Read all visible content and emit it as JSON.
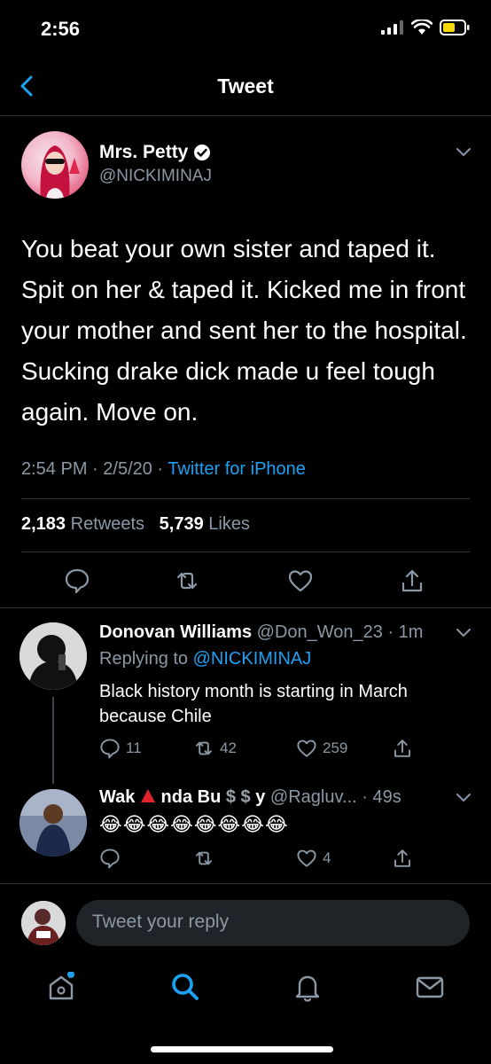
{
  "status": {
    "time": "2:56"
  },
  "header": {
    "title": "Tweet",
    "back_icon": "chevron-left-icon"
  },
  "main_tweet": {
    "author_name": "Mrs. Petty",
    "author_handle": "@NICKIMINAJ",
    "verified": true,
    "text": "You beat your own sister and taped it. Spit on her & taped it. Kicked me in front your mother and sent her to the hospital. Sucking drake dick made u feel tough again. Move on.",
    "time": "2:54 PM",
    "date": "2/5/20",
    "source": "Twitter for iPhone",
    "retweets_count": "2,183",
    "retweets_label": "Retweets",
    "likes_count": "5,739",
    "likes_label": "Likes"
  },
  "replies": [
    {
      "name": "Donovan Williams",
      "handle": "@Don_Won_23",
      "age": "1m",
      "replying_label": "Replying to",
      "replying_to": "@NICKIMINAJ",
      "text": "Black history month is starting in March because Chile",
      "reply_count": "11",
      "retweet_count": "42",
      "like_count": "259"
    },
    {
      "name_part1": "Wak",
      "name_part2": "nda Bu",
      "name_part3": "y",
      "handle": "@Ragluv...",
      "age": "49s",
      "text": "😂😂😂😂😂😂😂😂",
      "like_count": "4"
    }
  ],
  "composer": {
    "placeholder": "Tweet your reply"
  },
  "tabs": [
    "home-icon",
    "search-icon",
    "notifications-icon",
    "messages-icon"
  ],
  "colors": {
    "accent": "#1da1f2",
    "muted": "#8b98a5",
    "background": "#000000",
    "divider": "#2f3336"
  }
}
